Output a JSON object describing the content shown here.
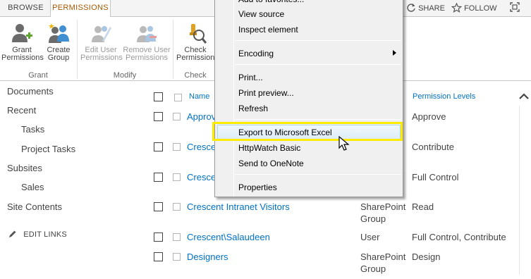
{
  "ribbon": {
    "tabs": [
      {
        "label": "BROWSE"
      },
      {
        "label": "PERMISSIONS"
      }
    ],
    "top_links": {
      "share": "SHARE",
      "follow": "FOLLOW"
    },
    "buttons": {
      "grant_line1": "Grant",
      "grant_line2": "Permissions",
      "create_line1": "Create",
      "create_line2": "Group",
      "edit_line1": "Edit User",
      "edit_line2": "Permissions",
      "remove_line1": "Remove User",
      "remove_line2": "Permissions",
      "check_line1": "Check",
      "check_line2": "Permission"
    },
    "groups": {
      "grant": "Grant",
      "modify": "Modify",
      "check": "Check"
    }
  },
  "quick_launch": {
    "items": [
      "Documents",
      "Recent",
      "Tasks",
      "Project Tasks",
      "Subsites",
      "Sales",
      "Site Contents"
    ],
    "edit_links": "EDIT LINKS"
  },
  "list": {
    "headers": {
      "name": "Name",
      "permission_levels": "Permission Levels"
    },
    "rows": [
      {
        "name": "Approv",
        "type": "",
        "type2": "",
        "permission": "Approve"
      },
      {
        "name": "Crescent",
        "type": "",
        "type2": "",
        "permission": "Contribute"
      },
      {
        "name": "Crescent",
        "type": "",
        "type2": "",
        "permission": "Full Control"
      },
      {
        "name": "Crescent Intranet Visitors",
        "type": "SharePoint",
        "type2": "Group",
        "permission": "Read"
      },
      {
        "name": "Crescent\\Salaudeen",
        "type": "User",
        "type2": "",
        "permission": "Full Control, Contribute"
      },
      {
        "name": "Designers",
        "type": "SharePoint",
        "type2": "Group",
        "permission": "Design"
      }
    ]
  },
  "context_menu": {
    "items": {
      "add_favorites": "Add to favorites...",
      "view_source": "View source",
      "inspect": "Inspect element",
      "encoding": "Encoding",
      "print": "Print...",
      "print_preview": "Print preview...",
      "refresh": "Refresh",
      "export_excel": "Export to Microsoft Excel",
      "httpwatch": "HttpWatch Basic",
      "onenote": "Send to OneNote",
      "properties": "Properties"
    }
  },
  "colors": {
    "accent": "#0072c6",
    "tab_active": "#a55800",
    "highlight": "#ffeb00"
  }
}
